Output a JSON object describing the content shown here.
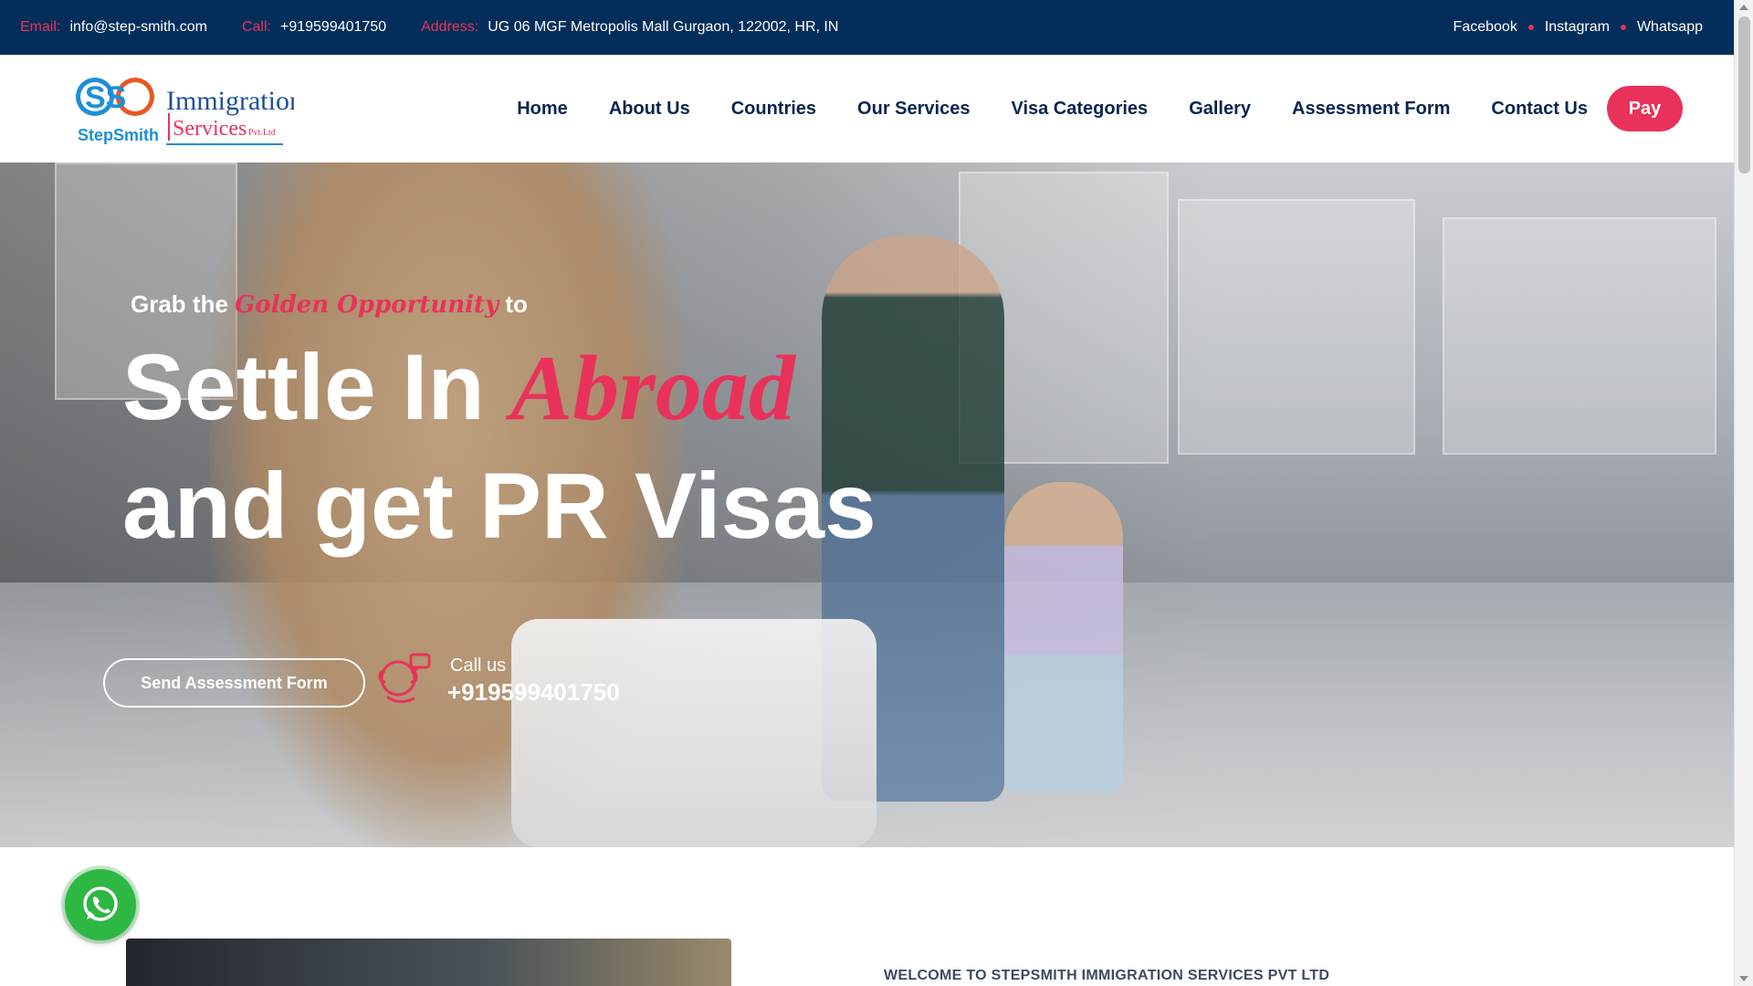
{
  "topbar": {
    "email_label": "Email:",
    "email": "info@step-smith.com",
    "call_label": "Call:",
    "phone": "+919599401750",
    "address_label": "Address:",
    "address": "UG 06 MGF Metropolis Mall Gurgaon, 122002, HR, IN",
    "social": [
      "Facebook",
      "Instagram",
      "Whatsapp"
    ]
  },
  "logo": {
    "monogram": "SS",
    "word1": "Immigration",
    "word2": "Services",
    "suffix": "Pvt.Ltd",
    "brand": "StepSmith"
  },
  "nav": {
    "items": [
      "Home",
      "About Us",
      "Countries",
      "Our Services",
      "Visa Categories",
      "Gallery",
      "Assessment Form",
      "Contact Us"
    ],
    "pay_label": "Pay"
  },
  "hero": {
    "tagline_pre": "Grab the",
    "tagline_accent": "Golden Opportunity",
    "tagline_post": "to",
    "line1_pre": "Settle In",
    "line1_accent": "Abroad",
    "line2": "and get PR Visas",
    "cta_label": "Send Assessment Form",
    "call_label": "Call us",
    "call_number": "+919599401750"
  },
  "about": {
    "welcome": "WELCOME TO STEPSMITH IMMIGRATION SERVICES PVT LTD"
  },
  "colors": {
    "topbar_bg": "#032e5b",
    "accent": "#e8325a",
    "nav_text": "#07264d",
    "whatsapp": "#2db743"
  },
  "icons": [
    "phone-support-icon",
    "whatsapp-icon"
  ]
}
